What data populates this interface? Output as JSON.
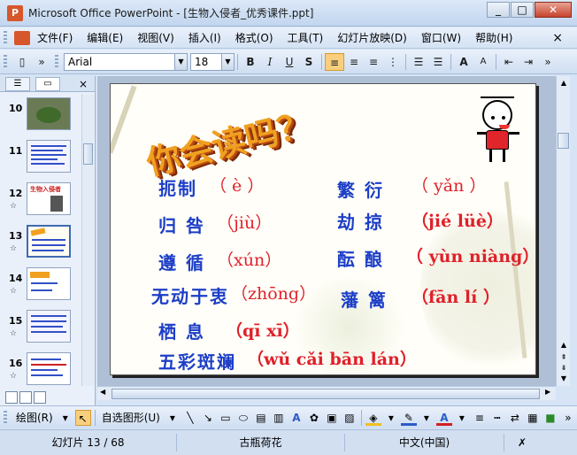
{
  "window": {
    "title": "Microsoft Office PowerPoint - [生物入侵者_优秀课件.ppt]",
    "minimize": "_",
    "restore": "□",
    "close": "✕"
  },
  "menu": {
    "items": [
      "文件(F)",
      "编辑(E)",
      "视图(V)",
      "插入(I)",
      "格式(O)",
      "工具(T)",
      "幻灯片放映(D)",
      "窗口(W)",
      "帮助(H)"
    ],
    "close_doc": "×"
  },
  "format_toolbar": {
    "font": "Arial",
    "size": "18",
    "bold": "B",
    "italic": "I",
    "underline": "U",
    "shadow": "S",
    "grow_font": "A",
    "shrink_font": "A"
  },
  "left_pane": {
    "thumbnails": [
      {
        "num": "10",
        "star": ""
      },
      {
        "num": "11",
        "star": ""
      },
      {
        "num": "12",
        "star": "☆"
      },
      {
        "num": "13",
        "star": "☆"
      },
      {
        "num": "14",
        "star": "☆"
      },
      {
        "num": "15",
        "star": "☆"
      },
      {
        "num": "16",
        "star": "☆"
      }
    ],
    "close": "×",
    "thumb12_title": "生物入侵者"
  },
  "slide": {
    "title": "你会读吗？",
    "rows": [
      {
        "word": "扼制",
        "pinyin": "（ è ）"
      },
      {
        "word": "繁 衍",
        "pinyin": "（ yǎn ）"
      },
      {
        "word": "归 咎",
        "pinyin": "（jiù）"
      },
      {
        "word": "劫 掠",
        "pinyin": "（jié lüè）"
      },
      {
        "word": "遵 循",
        "pinyin": "（xún）"
      },
      {
        "word": "酝 酿",
        "pinyin": "（ yùn niàng）"
      },
      {
        "word": "无动于衷",
        "pinyin": "（zhōng）"
      },
      {
        "word": "藩 篱",
        "pinyin": "（fān lí ）"
      },
      {
        "word": "栖 息",
        "pinyin": "（qī xī）"
      },
      {
        "word": "五彩斑斓",
        "pinyin": "（wǔ cǎi bān lán）"
      }
    ]
  },
  "draw_toolbar": {
    "draw_label": "绘图(R)",
    "autoshapes_label": "自选图形(U)"
  },
  "status": {
    "slide_info": "幻灯片 13 / 68",
    "design": "古瓶荷花",
    "language": "中文(中国)"
  }
}
